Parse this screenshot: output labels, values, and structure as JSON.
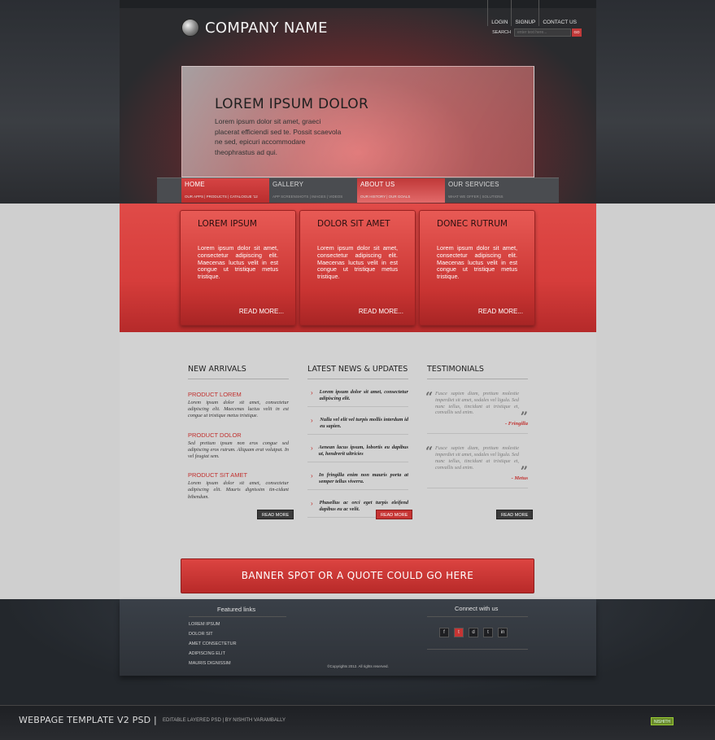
{
  "header": {
    "company": "COMPANY NAME",
    "toplinks": [
      "LOGIN",
      "SIGNUP",
      "CONTACT US"
    ],
    "search_label": "SEARCH",
    "search_placeholder": "enter text here...",
    "search_go": "GO"
  },
  "hero": {
    "title": "LOREM IPSUM DOLOR",
    "text": "Lorem ipsum dolor sit amet, graeci placerat efficiendi sed te. Possit scaevola ne sed, epicuri accommodare theophrastus ad qui."
  },
  "nav": [
    {
      "label": "HOME",
      "sub": "OUR APPS | PRODUCTS | CATALOGUE '12"
    },
    {
      "label": "GALLERY",
      "sub": "APP SCREENSHOTS | IMAGES | VIDEOS"
    },
    {
      "label": "ABOUT US",
      "sub": "OUR HISTORY | OUR GOALS"
    },
    {
      "label": "OUR SERVICES",
      "sub": "WHAT WE OFFER | SOLUTIONS"
    }
  ],
  "features": [
    {
      "title": "LOREM IPSUM",
      "text": "Lorem ipsum dolor sit amet, consectetur adipiscing elit. Maecenas luctus velit in est congue ut tristique metus tristique.",
      "more": "READ MORE..."
    },
    {
      "title": "DOLOR SIT AMET",
      "text": "Lorem ipsum dolor sit amet, consectetur adipiscing elit. Maecenas luctus velit in est congue ut tristique metus tristique.",
      "more": "READ MORE..."
    },
    {
      "title": "DONEC RUTRUM",
      "text": "Lorem ipsum dolor sit amet, consectetur adipiscing elit. Maecenas luctus velit in est congue ut tristique metus tristique.",
      "more": "READ MORE..."
    }
  ],
  "arrivals": {
    "title": "NEW ARRIVALS",
    "items": [
      {
        "title": "PRODUCT LOREM",
        "text": "Lorem ipsum dolor sit amet, consectetur adipiscing elit. Maecenas luctus velit in est congue ut tristique metus tristique."
      },
      {
        "title": "PRODUCT DOLOR",
        "text": "Sed pretium ipsum non eros congue sed adipiscing eros rutrum. Aliquam erat volutpat. In vel feugiat sem."
      },
      {
        "title": "PRODUCT SIT AMET",
        "text": "Lorem ipsum dolor sit amet, consectetur adipiscing elit. Mauris dignissim tin-cidunt bibendum."
      }
    ],
    "more": "READ MORE"
  },
  "news": {
    "title": "LATEST NEWS & UPDATES",
    "items": [
      "Lorem ipsum dolor sit amet, consectetur adipiscing elit.",
      "Nulla vel elit vel turpis mollis interdum id eu sapien.",
      "Aenean lacus ipsum, lobortis eu dapibus ut, hendrerit ultricies",
      "In fringilla enim non mauris porta at semper tellus viverra.",
      "Phasellus ac orci eget turpis eleifend dapibus eu ac velit."
    ],
    "more": "READ MORE"
  },
  "testimonials": {
    "title": "TESTIMONIALS",
    "items": [
      {
        "text": "Fusce sapien diam, pretium molestie imperdiet sit amet, sodales vel ligula. Sed nunc tellus, tincidunt at tristique et, convallis sed enim.",
        "author": "- Fringilla"
      },
      {
        "text": "Fusce sapien diam, pretium molestie imperdiet sit amet, sodales vel ligula. Sed nunc tellus, tincidunt at tristique et, convallis sed enim.",
        "author": "- Metus"
      }
    ],
    "more": "READ MORE"
  },
  "banner": "BANNER SPOT OR A QUOTE COULD GO HERE",
  "footer": {
    "featured_title": "Featured links",
    "links": [
      "LOREM IPSUM",
      "DOLOR SIT",
      "AMET CONSECTETUR",
      "ADIPISCING ELIT",
      "MAURIS DIGNISSIM"
    ],
    "connect_title": "Connect with us",
    "socials": [
      "f",
      "t",
      "d",
      "t",
      "in"
    ],
    "copyright": "©Copyrights 2012. All rights reserved."
  },
  "bottom": {
    "title": "WEBPAGE TEMPLATE V2 PSD |",
    "subtitle": "EDITABLE LAYERED PSD | BY NISHITH VARAMBALLY",
    "badge": "NISHITH"
  }
}
